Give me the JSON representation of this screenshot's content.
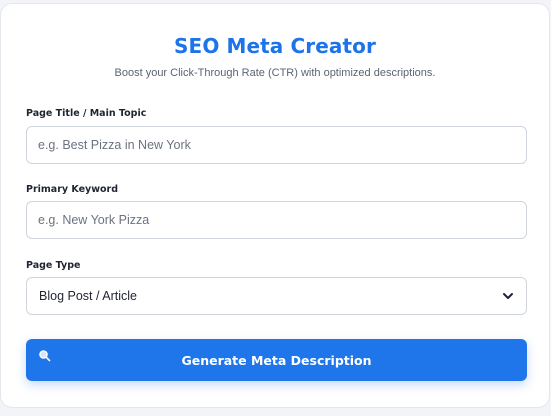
{
  "header": {
    "title": "SEO Meta Creator",
    "subtitle": "Boost your Click-Through Rate (CTR) with optimized descriptions."
  },
  "form": {
    "page_title": {
      "label": "Page Title / Main Topic",
      "placeholder": "e.g. Best Pizza in New York",
      "value": ""
    },
    "primary_keyword": {
      "label": "Primary Keyword",
      "placeholder": "e.g. New York Pizza",
      "value": ""
    },
    "page_type": {
      "label": "Page Type",
      "selected": "Blog Post / Article"
    },
    "submit": {
      "label": "Generate Meta Description",
      "icon": "magnifying-glass-icon"
    }
  },
  "colors": {
    "accent": "#1f75ea",
    "title": "#1e73e8",
    "background": "#ffffff"
  }
}
